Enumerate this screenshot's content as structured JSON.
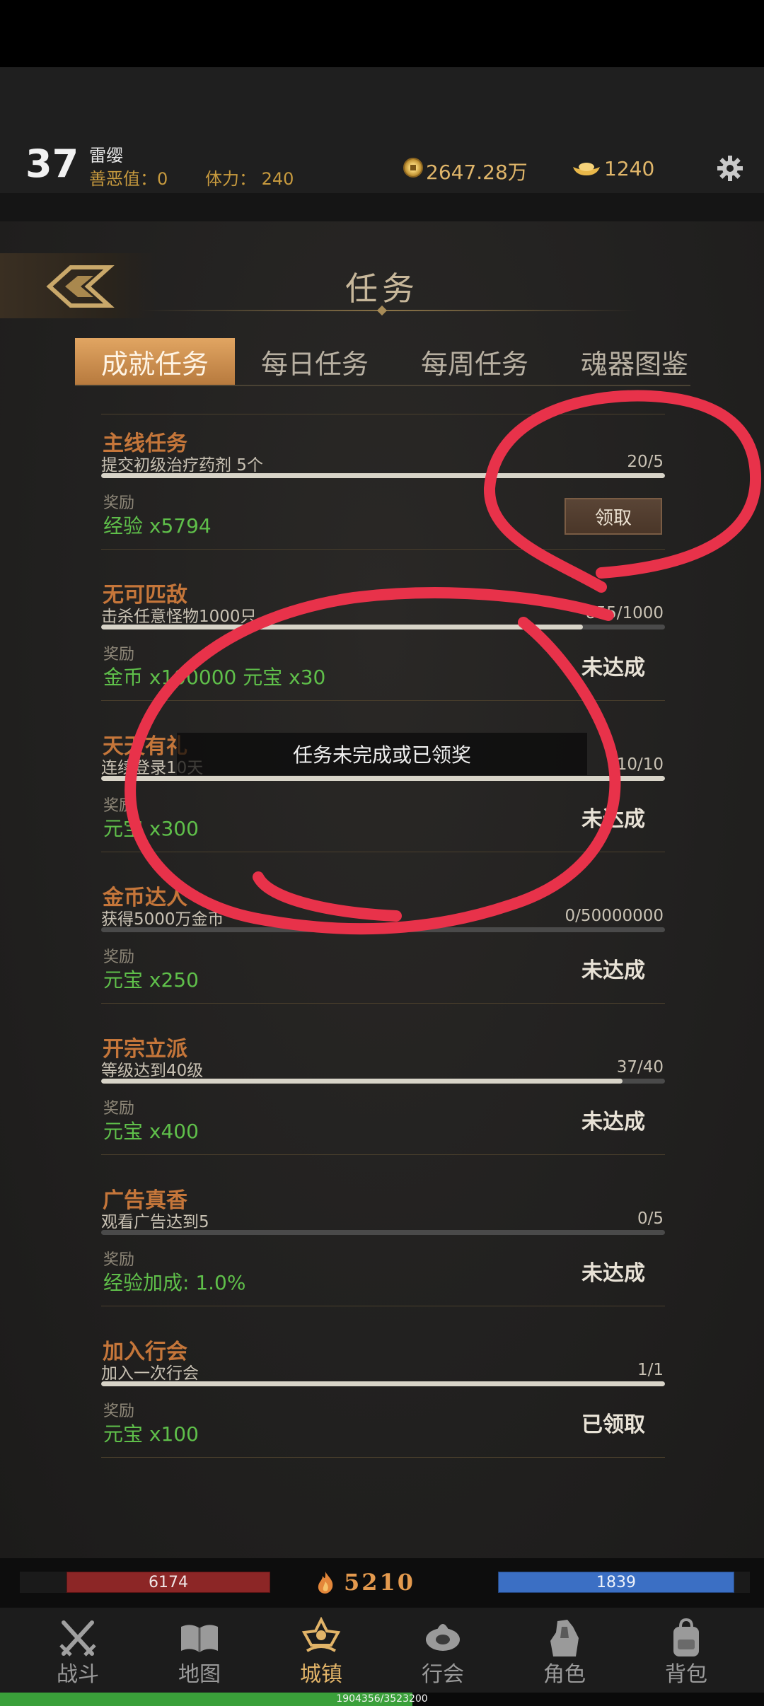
{
  "header": {
    "level": "37",
    "player_name": "雷缨",
    "karma": "善恶值：0",
    "stamina": "体力： 240",
    "gold": "2647.28万",
    "ingots": "1240"
  },
  "panel": {
    "title": "任务",
    "tabs": [
      {
        "label": "成就任务",
        "active": true
      },
      {
        "label": "每日任务",
        "active": false
      },
      {
        "label": "每周任务",
        "active": false
      },
      {
        "label": "魂器图鉴",
        "active": false
      }
    ]
  },
  "quests": [
    {
      "name": "主线任务",
      "desc": "提交初级治疗药剂 5个",
      "progress": "20/5",
      "progress_fraction": 1.0,
      "reward_label": "奖励",
      "reward": "经验 x5794",
      "status": "领取"
    },
    {
      "name": "无可匹敌",
      "desc": "击杀任意怪物1000只",
      "progress": "855/1000",
      "progress_fraction": 0.855,
      "reward_label": "奖励",
      "reward": "金币 x100000   元宝 x30",
      "status": "未达成"
    },
    {
      "name": "天天有礼",
      "desc": "连续登录10天",
      "progress": "10/10",
      "progress_fraction": 1.0,
      "reward_label": "奖励",
      "reward": "元宝 x300",
      "status": "未达成"
    },
    {
      "name": "金币达人",
      "desc": "获得5000万金币",
      "progress": "0/50000000",
      "progress_fraction": 0.0,
      "reward_label": "奖励",
      "reward": "元宝 x250",
      "status": "未达成"
    },
    {
      "name": "开宗立派",
      "desc": "等级达到40级",
      "progress": "37/40",
      "progress_fraction": 0.925,
      "reward_label": "奖励",
      "reward": "元宝 x400",
      "status": "未达成"
    },
    {
      "name": "广告真香",
      "desc": "观看广告达到5",
      "progress": "0/5",
      "progress_fraction": 0.0,
      "reward_label": "奖励",
      "reward": "经验加成: 1.0%",
      "status": "未达成"
    },
    {
      "name": "加入行会",
      "desc": "加入一次行会",
      "progress": "1/1",
      "progress_fraction": 1.0,
      "reward_label": "奖励",
      "reward": "元宝 x100",
      "status": "已领取"
    }
  ],
  "toast": "任务未完成或已领奖",
  "stats": {
    "hp": "6174",
    "power": "5210",
    "mp": "1839"
  },
  "nav": [
    {
      "label": "战斗",
      "icon": "crossed-swords-icon",
      "active": false
    },
    {
      "label": "地图",
      "icon": "book-map-icon",
      "active": false
    },
    {
      "label": "城镇",
      "icon": "town-crown-icon",
      "active": true
    },
    {
      "label": "行会",
      "icon": "guild-emblem-icon",
      "active": false
    },
    {
      "label": "角色",
      "icon": "character-icon",
      "active": false
    },
    {
      "label": "背包",
      "icon": "backpack-icon",
      "active": false
    }
  ],
  "xp": {
    "text": "1904356/3523200",
    "fraction": 0.54
  },
  "colors": {
    "accent": "#c5763a",
    "reward_green": "#5fbf4a",
    "tab_active": "#d39454",
    "annotation_red": "#e8324a"
  }
}
